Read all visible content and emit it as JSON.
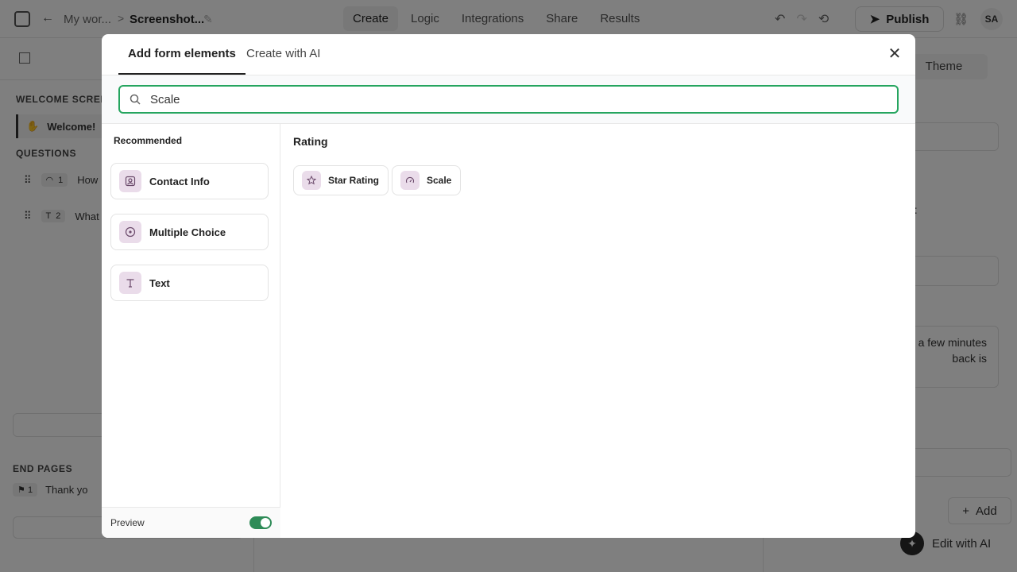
{
  "app": {
    "breadcrumb_workspace": "My wor...",
    "breadcrumb_separator": ">",
    "breadcrumb_form": "Screenshot...",
    "nav": [
      "Create",
      "Logic",
      "Integrations",
      "Share",
      "Results"
    ],
    "publish_label": "Publish",
    "avatar_initials": "SA"
  },
  "left_panel": {
    "welcome_section": "WELCOME SCREE",
    "welcome_item": "Welcome!",
    "questions_section": "QUESTIONS",
    "questions": [
      {
        "number": "1",
        "label": "How"
      },
      {
        "number": "2",
        "label": "What"
      }
    ],
    "add_label": "+",
    "end_pages_section": "END PAGES",
    "end_page": {
      "number": "1",
      "label": "Thank yo"
    }
  },
  "right_panel": {
    "theme_tab": "Theme",
    "bold_fragment": "t",
    "textarea_text": "a few minutes\nback is",
    "add_button": "Add",
    "edit_ai_label": "Edit with AI"
  },
  "modal": {
    "tabs": [
      "Add form elements",
      "Create with AI"
    ],
    "active_tab": 0,
    "close_icon": "close-icon",
    "search": {
      "value": "Scale",
      "icon": "search-icon"
    },
    "recommended_label": "Recommended",
    "recommended": [
      {
        "label": "Contact Info",
        "icon": "contact-card-icon"
      },
      {
        "label": "Multiple Choice",
        "icon": "radio-circle-icon"
      },
      {
        "label": "Text",
        "icon": "text-t-icon"
      }
    ],
    "result_group_title": "Rating",
    "results": [
      {
        "label": "Star Rating",
        "icon": "star-icon"
      },
      {
        "label": "Scale",
        "icon": "gauge-icon"
      }
    ],
    "preview_label": "Preview",
    "preview_enabled": true
  },
  "colors": {
    "accent_green": "#25a55f",
    "toggle_green": "#2e8b57",
    "icon_bg": "#eadcea"
  }
}
